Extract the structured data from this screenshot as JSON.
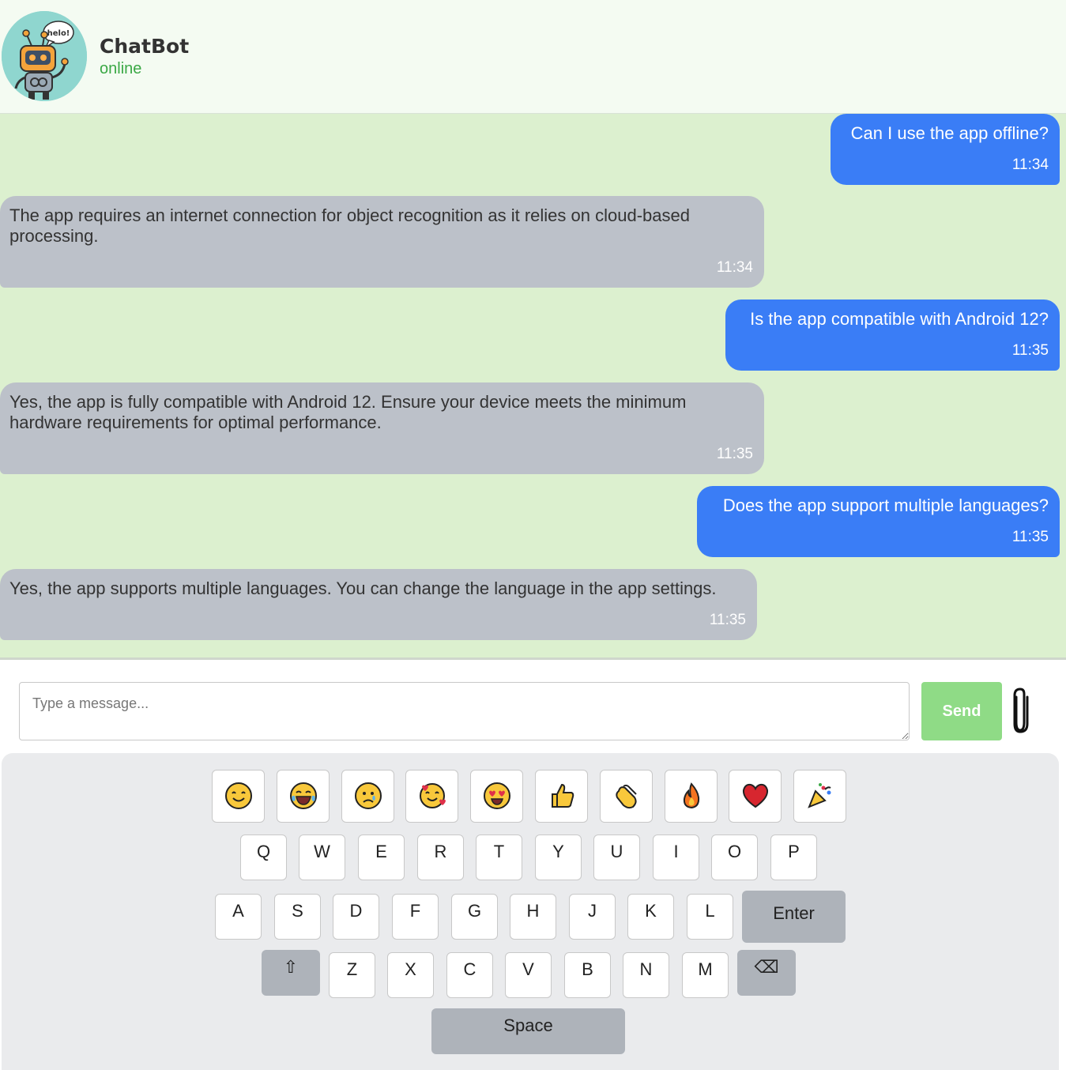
{
  "header": {
    "bot_name": "ChatBot",
    "status": "online",
    "avatar_bubble_text": "helo!"
  },
  "messages": [
    {
      "sender": "user",
      "text": "Can I use the app offline?",
      "time": "11:34"
    },
    {
      "sender": "bot",
      "text": "The app requires an internet connection for object recognition as it relies on cloud-based processing.",
      "time": "11:34"
    },
    {
      "sender": "user",
      "text": "Is the app compatible with Android 12?",
      "time": "11:35"
    },
    {
      "sender": "bot",
      "text": "Yes, the app is fully compatible with Android 12. Ensure your device meets the minimum hardware requirements for optimal performance.",
      "time": "11:35"
    },
    {
      "sender": "user",
      "text": "Does the app support multiple languages?",
      "time": "11:35"
    },
    {
      "sender": "bot",
      "text": "Yes, the app supports multiple languages. You can change the language in the app settings.",
      "time": "11:35"
    }
  ],
  "composer": {
    "placeholder": "Type a message...",
    "value": "",
    "send_label": "Send",
    "attach_icon": "paperclip-icon"
  },
  "keyboard": {
    "emojis": [
      "smiling-face",
      "face-with-tears-of-joy",
      "crying-face",
      "smiling-face-with-hearts",
      "heart-eyes-face",
      "thumbs-up",
      "clapping-hands",
      "fire",
      "red-heart",
      "party-popper"
    ],
    "row1": [
      "Q",
      "W",
      "E",
      "R",
      "T",
      "Y",
      "U",
      "I",
      "O",
      "P"
    ],
    "row2": [
      "A",
      "S",
      "D",
      "F",
      "G",
      "H",
      "J",
      "K",
      "L"
    ],
    "row3": [
      "Z",
      "X",
      "C",
      "V",
      "B",
      "N",
      "M"
    ],
    "enter_label": "Enter",
    "shift_label": "⇧",
    "backspace_label": "⌫",
    "space_label": "Space"
  },
  "colors": {
    "user_bubble": "#3a7df6",
    "bot_bubble": "#bcc1c9",
    "chat_bg": "#dcf0cf",
    "send_button": "#8fdb86",
    "status": "#3aa845"
  }
}
